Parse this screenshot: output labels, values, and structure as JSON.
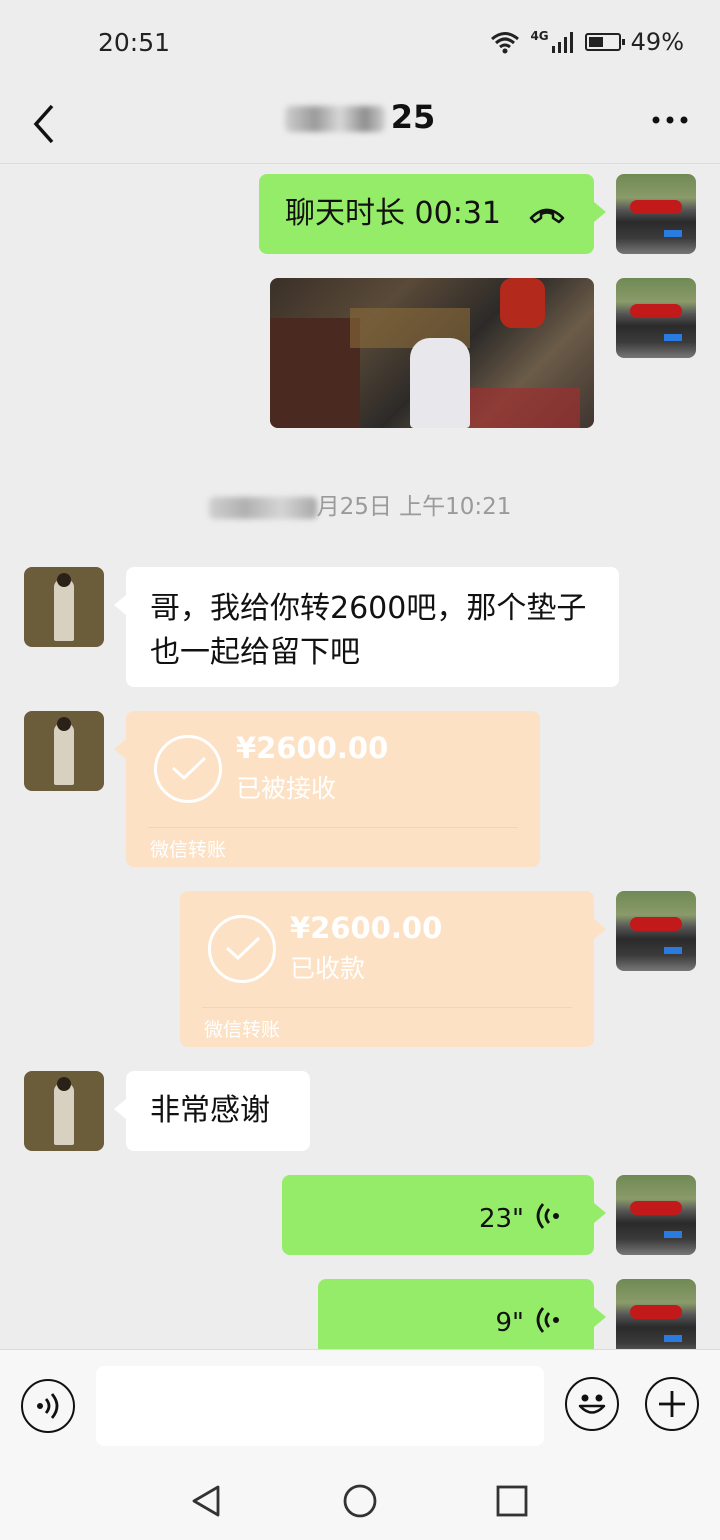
{
  "status_bar": {
    "time": "20:51",
    "network": "4G",
    "battery": "49%"
  },
  "header": {
    "title": "25"
  },
  "messages": {
    "call": {
      "text": "聊天时长 00:31"
    },
    "timestamp": {
      "visible": "月25日 上午10:21"
    },
    "text1": {
      "text": "哥，我给你转2600吧，那个垫子也一起给留下吧"
    },
    "transfer_in": {
      "amount": "¥2600.00",
      "status": "已被接收",
      "footer": "微信转账"
    },
    "transfer_out": {
      "amount": "¥2600.00",
      "status": "已收款",
      "footer": "微信转账"
    },
    "text2": {
      "text": "非常感谢"
    },
    "voice1": {
      "duration": "23\""
    },
    "voice2": {
      "duration": "9\""
    }
  },
  "input_bar": {
    "placeholder": ""
  },
  "icons": {
    "back": "back-arrow-icon",
    "more": "more-dots-icon",
    "call": "phone-hangup-icon",
    "voice": "voice-wave-icon",
    "emoji": "emoji-icon",
    "plus": "plus-icon"
  },
  "colors": {
    "sent_bubble": "#95ec69",
    "received_bubble": "#ffffff",
    "transfer": "#fde1c4",
    "background": "#ededed"
  }
}
